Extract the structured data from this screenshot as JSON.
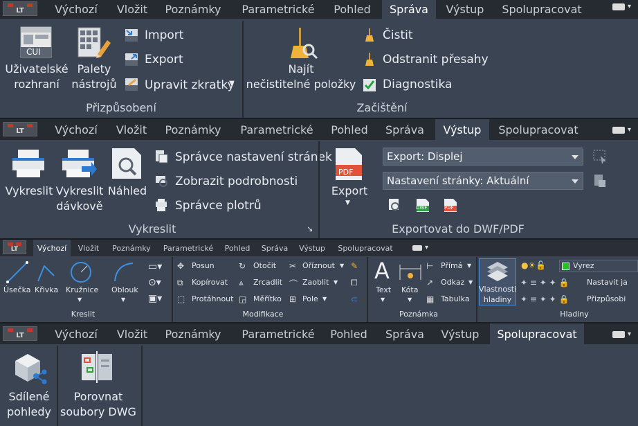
{
  "logo_text": "LT",
  "tabs_main": [
    "Výchozí",
    "Vložit",
    "Poznámky",
    "Parametrické",
    "Pohled",
    "Správa",
    "Výstup",
    "Spolupracovat"
  ],
  "strip1": {
    "active_tab": "Správa",
    "cui_badge": "CUI",
    "btn_ui": [
      "Uživatelské",
      "rozhraní"
    ],
    "btn_palettes": [
      "Palety",
      "nástrojů"
    ],
    "import": "Import",
    "export": "Export",
    "shortcuts": "Upravit zkratky",
    "panel_customize": "Přizpůsobení",
    "btn_find": [
      "Najít",
      "nečistitelné položky"
    ],
    "purge": "Čistit",
    "overlaps": "Odstranit přesahy",
    "diagnostics": "Diagnostika",
    "panel_cleanup": "Začištění"
  },
  "strip2": {
    "active_tab": "Výstup",
    "plot": "Vykreslit",
    "batch": [
      "Vykreslit",
      "dávkově"
    ],
    "preview": "Náhled",
    "page_setup": "Správce nastavení stránek",
    "details": "Zobrazit podrobnosti",
    "plotter_mgr": "Správce plotrů",
    "panel_plot": "Vykreslit",
    "export_btn": "Export",
    "pdf_label": "PDF",
    "dropdown_export": "Export: Displej",
    "dropdown_setup": "Nastavení stránky: Aktuální",
    "dwf_label": "DWF",
    "panel_export": "Exportovat do DWF/PDF"
  },
  "strip3": {
    "active_tab": "Výchozí",
    "draw": [
      "Úsečka",
      "Křivka",
      "Kružnice",
      "Oblouk"
    ],
    "panel_draw": "Kreslit",
    "modify_col1": [
      "Posun",
      "Kopírovat",
      "Protáhnout"
    ],
    "modify_col2": [
      "Otočit",
      "Zrcadlit",
      "Měřítko"
    ],
    "modify_col3": [
      "Oříznout",
      "Zaoblit",
      "Pole"
    ],
    "panel_modify": "Modifikace",
    "text": "Text",
    "dimension": "Kóta",
    "annot": [
      "Přímá",
      "Odkaz",
      "Tabulka"
    ],
    "panel_annot": "Poznámka",
    "layer_props": [
      "Vlastnosti",
      "hladiny"
    ],
    "layer_name": "Vyrez",
    "layer_actions": [
      "Nastavit ja",
      "Přizpůsobi"
    ],
    "panel_layers": "Hladiny"
  },
  "strip4": {
    "active_tab": "Spolupracovat",
    "shared": [
      "Sdílené",
      "pohledy"
    ],
    "compare": [
      "Porovnat",
      "soubory DWG"
    ]
  },
  "colors": {
    "ribbon_bg": "#3b4453",
    "tab_bg": "#262a31",
    "accent_blue": "#4a90d9",
    "layer_green": "#22c31d"
  }
}
